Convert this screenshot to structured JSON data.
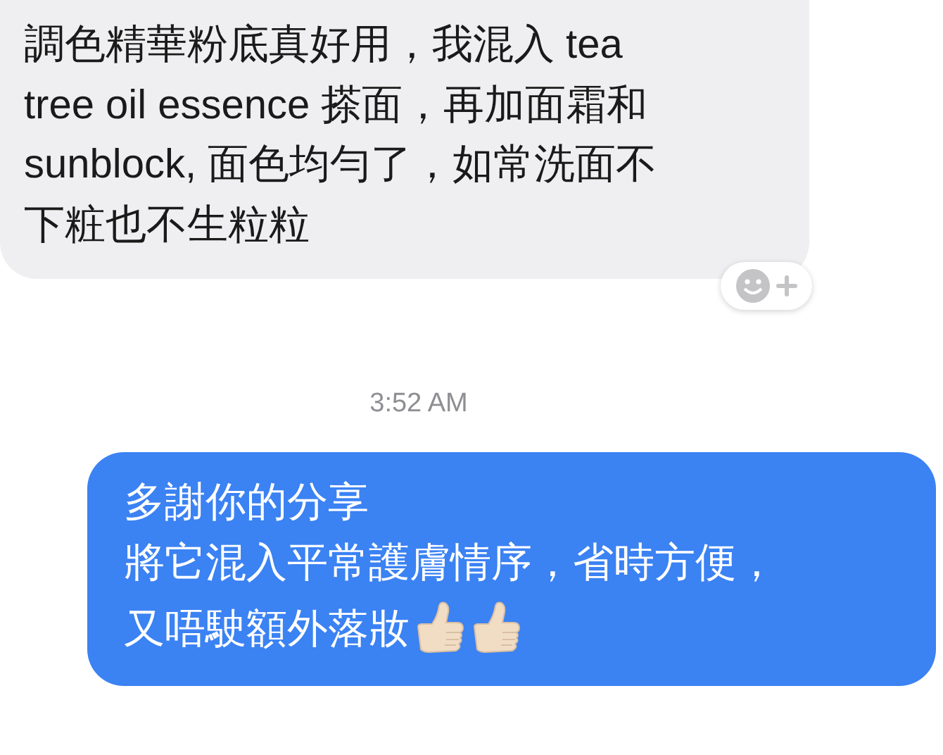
{
  "messages": [
    {
      "kind": "received",
      "lines": [
        "調色精華粉底真好用，我混入 tea",
        "tree oil essence 搽面，再加面霜和",
        "sunblock, 面色均勻了，如常洗面不",
        "下粧也不生粒粒"
      ]
    },
    {
      "kind": "timestamp",
      "text": "3:52 AM"
    },
    {
      "kind": "sent",
      "lines": [
        "多謝你的分享",
        "將它混入平常護膚情序，省時方便，",
        "又唔駛額外落妝"
      ]
    }
  ]
}
